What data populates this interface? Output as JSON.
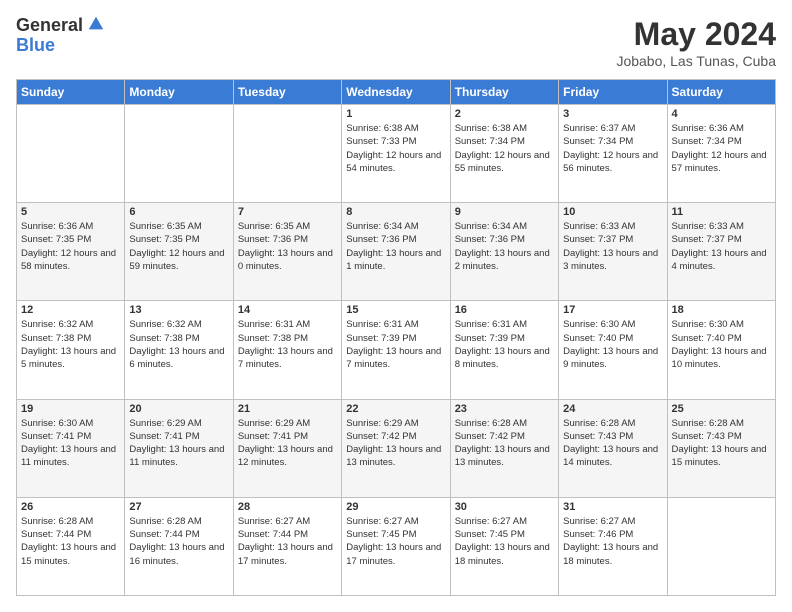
{
  "header": {
    "logo_general": "General",
    "logo_blue": "Blue",
    "month_title": "May 2024",
    "location": "Jobabo, Las Tunas, Cuba"
  },
  "days_of_week": [
    "Sunday",
    "Monday",
    "Tuesday",
    "Wednesday",
    "Thursday",
    "Friday",
    "Saturday"
  ],
  "weeks": [
    [
      {
        "num": "",
        "sunrise": "",
        "sunset": "",
        "daylight": ""
      },
      {
        "num": "",
        "sunrise": "",
        "sunset": "",
        "daylight": ""
      },
      {
        "num": "",
        "sunrise": "",
        "sunset": "",
        "daylight": ""
      },
      {
        "num": "1",
        "sunrise": "Sunrise: 6:38 AM",
        "sunset": "Sunset: 7:33 PM",
        "daylight": "Daylight: 12 hours and 54 minutes."
      },
      {
        "num": "2",
        "sunrise": "Sunrise: 6:38 AM",
        "sunset": "Sunset: 7:34 PM",
        "daylight": "Daylight: 12 hours and 55 minutes."
      },
      {
        "num": "3",
        "sunrise": "Sunrise: 6:37 AM",
        "sunset": "Sunset: 7:34 PM",
        "daylight": "Daylight: 12 hours and 56 minutes."
      },
      {
        "num": "4",
        "sunrise": "Sunrise: 6:36 AM",
        "sunset": "Sunset: 7:34 PM",
        "daylight": "Daylight: 12 hours and 57 minutes."
      }
    ],
    [
      {
        "num": "5",
        "sunrise": "Sunrise: 6:36 AM",
        "sunset": "Sunset: 7:35 PM",
        "daylight": "Daylight: 12 hours and 58 minutes."
      },
      {
        "num": "6",
        "sunrise": "Sunrise: 6:35 AM",
        "sunset": "Sunset: 7:35 PM",
        "daylight": "Daylight: 12 hours and 59 minutes."
      },
      {
        "num": "7",
        "sunrise": "Sunrise: 6:35 AM",
        "sunset": "Sunset: 7:36 PM",
        "daylight": "Daylight: 13 hours and 0 minutes."
      },
      {
        "num": "8",
        "sunrise": "Sunrise: 6:34 AM",
        "sunset": "Sunset: 7:36 PM",
        "daylight": "Daylight: 13 hours and 1 minute."
      },
      {
        "num": "9",
        "sunrise": "Sunrise: 6:34 AM",
        "sunset": "Sunset: 7:36 PM",
        "daylight": "Daylight: 13 hours and 2 minutes."
      },
      {
        "num": "10",
        "sunrise": "Sunrise: 6:33 AM",
        "sunset": "Sunset: 7:37 PM",
        "daylight": "Daylight: 13 hours and 3 minutes."
      },
      {
        "num": "11",
        "sunrise": "Sunrise: 6:33 AM",
        "sunset": "Sunset: 7:37 PM",
        "daylight": "Daylight: 13 hours and 4 minutes."
      }
    ],
    [
      {
        "num": "12",
        "sunrise": "Sunrise: 6:32 AM",
        "sunset": "Sunset: 7:38 PM",
        "daylight": "Daylight: 13 hours and 5 minutes."
      },
      {
        "num": "13",
        "sunrise": "Sunrise: 6:32 AM",
        "sunset": "Sunset: 7:38 PM",
        "daylight": "Daylight: 13 hours and 6 minutes."
      },
      {
        "num": "14",
        "sunrise": "Sunrise: 6:31 AM",
        "sunset": "Sunset: 7:38 PM",
        "daylight": "Daylight: 13 hours and 7 minutes."
      },
      {
        "num": "15",
        "sunrise": "Sunrise: 6:31 AM",
        "sunset": "Sunset: 7:39 PM",
        "daylight": "Daylight: 13 hours and 7 minutes."
      },
      {
        "num": "16",
        "sunrise": "Sunrise: 6:31 AM",
        "sunset": "Sunset: 7:39 PM",
        "daylight": "Daylight: 13 hours and 8 minutes."
      },
      {
        "num": "17",
        "sunrise": "Sunrise: 6:30 AM",
        "sunset": "Sunset: 7:40 PM",
        "daylight": "Daylight: 13 hours and 9 minutes."
      },
      {
        "num": "18",
        "sunrise": "Sunrise: 6:30 AM",
        "sunset": "Sunset: 7:40 PM",
        "daylight": "Daylight: 13 hours and 10 minutes."
      }
    ],
    [
      {
        "num": "19",
        "sunrise": "Sunrise: 6:30 AM",
        "sunset": "Sunset: 7:41 PM",
        "daylight": "Daylight: 13 hours and 11 minutes."
      },
      {
        "num": "20",
        "sunrise": "Sunrise: 6:29 AM",
        "sunset": "Sunset: 7:41 PM",
        "daylight": "Daylight: 13 hours and 11 minutes."
      },
      {
        "num": "21",
        "sunrise": "Sunrise: 6:29 AM",
        "sunset": "Sunset: 7:41 PM",
        "daylight": "Daylight: 13 hours and 12 minutes."
      },
      {
        "num": "22",
        "sunrise": "Sunrise: 6:29 AM",
        "sunset": "Sunset: 7:42 PM",
        "daylight": "Daylight: 13 hours and 13 minutes."
      },
      {
        "num": "23",
        "sunrise": "Sunrise: 6:28 AM",
        "sunset": "Sunset: 7:42 PM",
        "daylight": "Daylight: 13 hours and 13 minutes."
      },
      {
        "num": "24",
        "sunrise": "Sunrise: 6:28 AM",
        "sunset": "Sunset: 7:43 PM",
        "daylight": "Daylight: 13 hours and 14 minutes."
      },
      {
        "num": "25",
        "sunrise": "Sunrise: 6:28 AM",
        "sunset": "Sunset: 7:43 PM",
        "daylight": "Daylight: 13 hours and 15 minutes."
      }
    ],
    [
      {
        "num": "26",
        "sunrise": "Sunrise: 6:28 AM",
        "sunset": "Sunset: 7:44 PM",
        "daylight": "Daylight: 13 hours and 15 minutes."
      },
      {
        "num": "27",
        "sunrise": "Sunrise: 6:28 AM",
        "sunset": "Sunset: 7:44 PM",
        "daylight": "Daylight: 13 hours and 16 minutes."
      },
      {
        "num": "28",
        "sunrise": "Sunrise: 6:27 AM",
        "sunset": "Sunset: 7:44 PM",
        "daylight": "Daylight: 13 hours and 17 minutes."
      },
      {
        "num": "29",
        "sunrise": "Sunrise: 6:27 AM",
        "sunset": "Sunset: 7:45 PM",
        "daylight": "Daylight: 13 hours and 17 minutes."
      },
      {
        "num": "30",
        "sunrise": "Sunrise: 6:27 AM",
        "sunset": "Sunset: 7:45 PM",
        "daylight": "Daylight: 13 hours and 18 minutes."
      },
      {
        "num": "31",
        "sunrise": "Sunrise: 6:27 AM",
        "sunset": "Sunset: 7:46 PM",
        "daylight": "Daylight: 13 hours and 18 minutes."
      },
      {
        "num": "",
        "sunrise": "",
        "sunset": "",
        "daylight": ""
      }
    ]
  ]
}
